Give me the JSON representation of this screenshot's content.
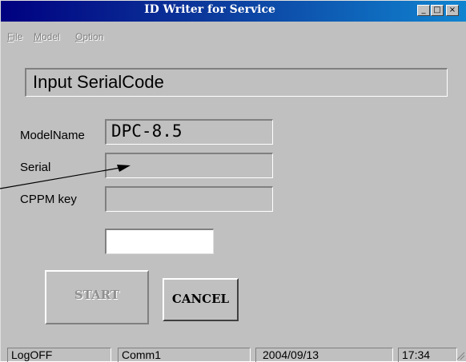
{
  "window": {
    "title": "ID Writer for Service",
    "minimize": "_",
    "maximize": "□",
    "close": "×"
  },
  "menu": {
    "items": [
      "File",
      "Model",
      "Option"
    ],
    "mnemonics": [
      "F",
      "M",
      "O"
    ]
  },
  "headline": "Input SerialCode",
  "fields": {
    "model_name": {
      "label": "ModelName",
      "value": "DPC-8.5"
    },
    "serial": {
      "label": "Serial",
      "value": ""
    },
    "cppm_key": {
      "label": "CPPM key",
      "value": ""
    }
  },
  "buttons": {
    "start": "START",
    "cancel": "CANCEL"
  },
  "status": {
    "login": "LogOFF",
    "port": "Comm1",
    "date": "2004/09/13",
    "time": "17:34"
  }
}
